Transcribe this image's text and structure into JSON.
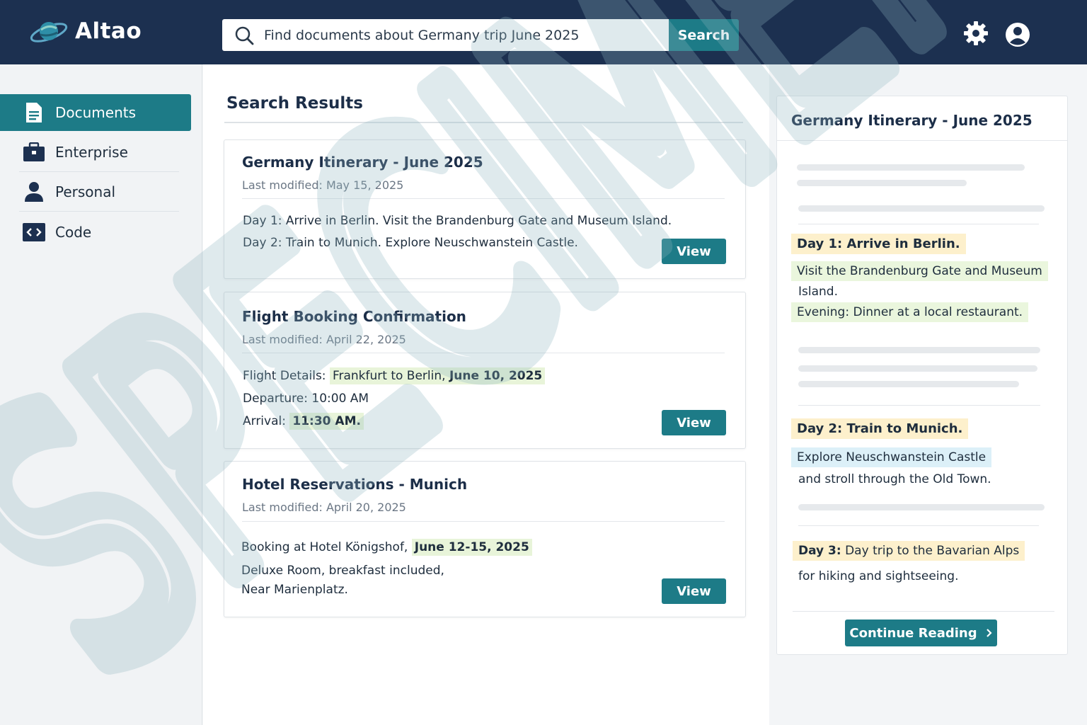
{
  "app": {
    "name": "Altao"
  },
  "search": {
    "value": "Find documents about Germany trip June 2025",
    "button_label": "Search"
  },
  "icons": {
    "logo": "planet-logo-icon",
    "search": "search-icon",
    "settings": "gear-icon",
    "account": "user-avatar-icon",
    "documents": "document-icon",
    "enterprise": "briefcase-icon",
    "personal": "person-icon",
    "code": "code-icon",
    "continue": "chevron-right-icon"
  },
  "colors": {
    "topbar": "#1c3050",
    "accent": "#1d7b87",
    "highlight_yellow": "#fdf0cc",
    "highlight_green": "#eaf6dd",
    "highlight_blue": "#dcf0f8"
  },
  "sidebar": {
    "items": [
      {
        "label": "Documents",
        "active": true
      },
      {
        "label": "Enterprise",
        "active": false
      },
      {
        "label": "Personal",
        "active": false
      },
      {
        "label": "Code",
        "active": false
      }
    ]
  },
  "results": {
    "title": "Search Results",
    "cards": [
      {
        "title": "Germany Itinerary - June 2025",
        "meta": "Last modified: May 15, 2025",
        "line1_a": "Day 1: Arrive in Berlin.",
        "line1_b": " Visit the Brandenburg Gate and Museum Island.",
        "line2": "Day 2: Train to Munich. Explore Neuschwanstein Castle.",
        "button": "View"
      },
      {
        "title": "Flight Booking Confirmation",
        "meta": "Last modified: April 22, 2025",
        "line1_a": "Flight Details: ",
        "line1_hl": "Frankfurt to Berlin, ",
        "line1_bold": "June 10, 2025",
        "line2_a": "Departure: ",
        "line2_b": "10:00 AM",
        "line3_a": "Arrival: ",
        "line3_b": "11:30 AM.",
        "button": "View"
      },
      {
        "title": "Hotel Reservations - Munich",
        "meta": "Last modified: April 20, 2025",
        "line1_a": "Booking at Hotel Königshof, ",
        "line1_bold": "June 12-15, 2025",
        "line2": "Deluxe Room, breakfast included,",
        "line3": "Near Marienplatz.",
        "button": "View"
      }
    ]
  },
  "preview": {
    "title": "Germany Itinerary - June 2025",
    "day1_heading": "Day 1: Arrive in Berlin.",
    "day1_line1": "Visit the Brandenburg Gate and Museum",
    "day1_line2": "Island.",
    "day1_line3": "Evening: Dinner at a local restaurant.",
    "day2_heading": "Day 2: Train to Munich.",
    "day2_line1": "Explore Neuschwanstein Castle",
    "day2_line2": "and stroll through the Old Town.",
    "day3_label": "Day 3:",
    "day3_rest": " Day trip to the Bavarian Alps",
    "day3_line2": "for hiking and sightseeing.",
    "continue_label": "Continue Reading"
  },
  "watermark": {
    "text": "SPECIMEN"
  }
}
